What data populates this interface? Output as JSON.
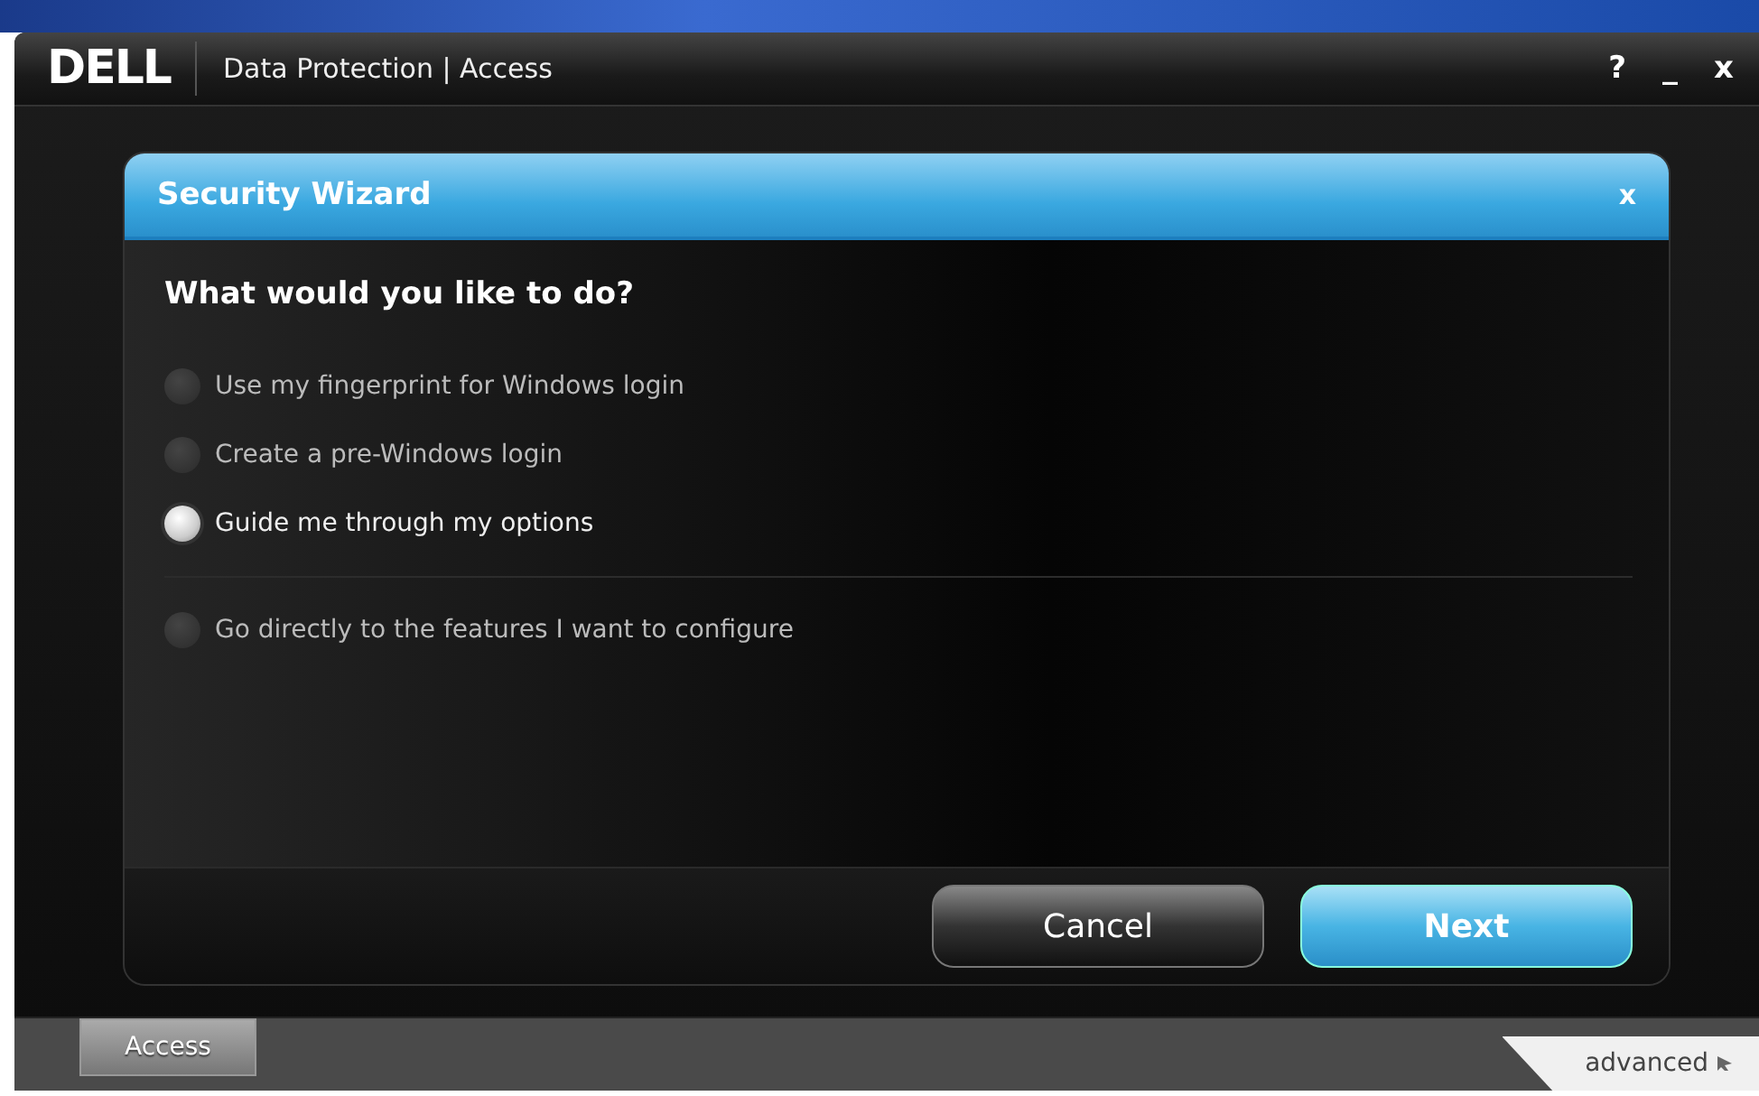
{
  "app": {
    "logo": "DELL",
    "title": "Data Protection | Access",
    "help": "?",
    "minimize": "_",
    "close": "x"
  },
  "dialog": {
    "title": "Security Wizard",
    "close": "x",
    "question": "What would you like to do?",
    "options": [
      {
        "label": "Use my fingerprint for Windows login",
        "selected": false
      },
      {
        "label": "Create a pre-Windows login",
        "selected": false
      },
      {
        "label": "Guide me through my options",
        "selected": true
      },
      {
        "label": "Go directly to the features I want to configure",
        "selected": false,
        "separated": true
      }
    ],
    "buttons": [
      {
        "label": "Cancel",
        "kind": "secondary"
      },
      {
        "label": "Next",
        "kind": "primary"
      }
    ]
  },
  "bottom_bar": {
    "tab": "Access",
    "advanced": "advanced"
  }
}
